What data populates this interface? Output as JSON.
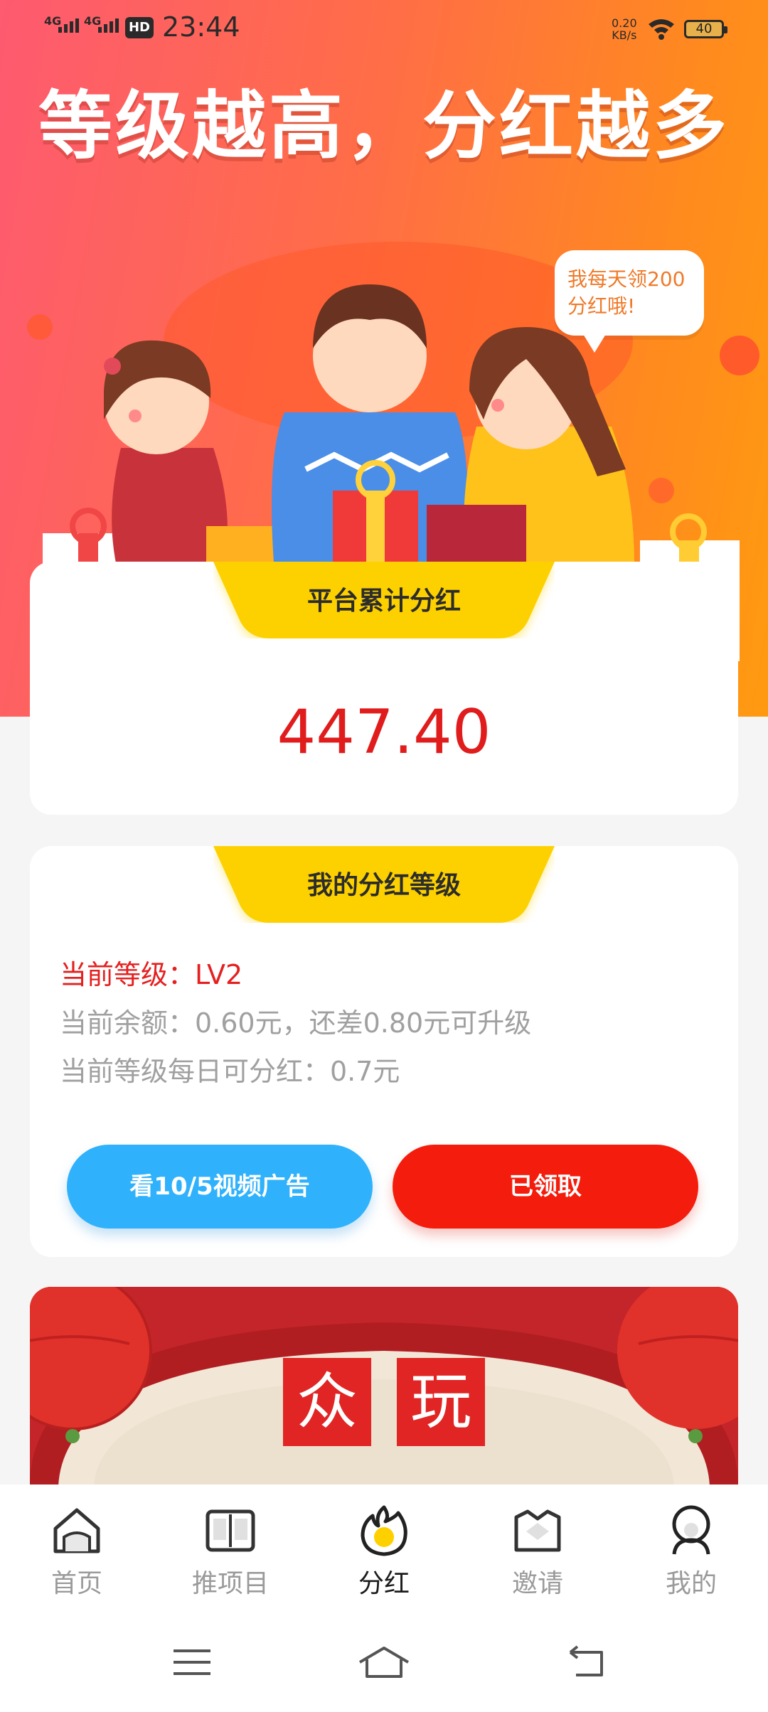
{
  "status_bar": {
    "network1": "4G",
    "network2": "4G",
    "hd": "HD",
    "time": "23:44",
    "net_speed_value": "0.20",
    "net_speed_unit": "KB/s",
    "battery": "40"
  },
  "hero": {
    "title": "等级越高，分红越多",
    "bubble_line1": "我每天领200",
    "bubble_line2": "分红哦!"
  },
  "total_card": {
    "tab_label": "平台累计分红",
    "value": "447.40"
  },
  "level_card": {
    "tab_label": "我的分红等级",
    "current_level": "当前等级：LV2",
    "balance_line": "当前余额：0.60元，还差0.80元可升级",
    "daily_line": "当前等级每日可分红：0.7元",
    "video_button": "看10/5视频广告",
    "claimed_button": "已领取"
  },
  "banner": {
    "stamp1": "众",
    "stamp2": "玩"
  },
  "nav": {
    "items": [
      {
        "label": "首页",
        "icon": "home-icon"
      },
      {
        "label": "推项目",
        "icon": "book-icon"
      },
      {
        "label": "分红",
        "icon": "flame-icon",
        "active": true
      },
      {
        "label": "邀请",
        "icon": "invite-icon"
      },
      {
        "label": "我的",
        "icon": "profile-icon"
      }
    ]
  },
  "colors": {
    "accent_red": "#e01c1c",
    "button_blue": "#2fb2fb",
    "button_red": "#f41c0c",
    "tab_yellow": "#fdd100"
  }
}
